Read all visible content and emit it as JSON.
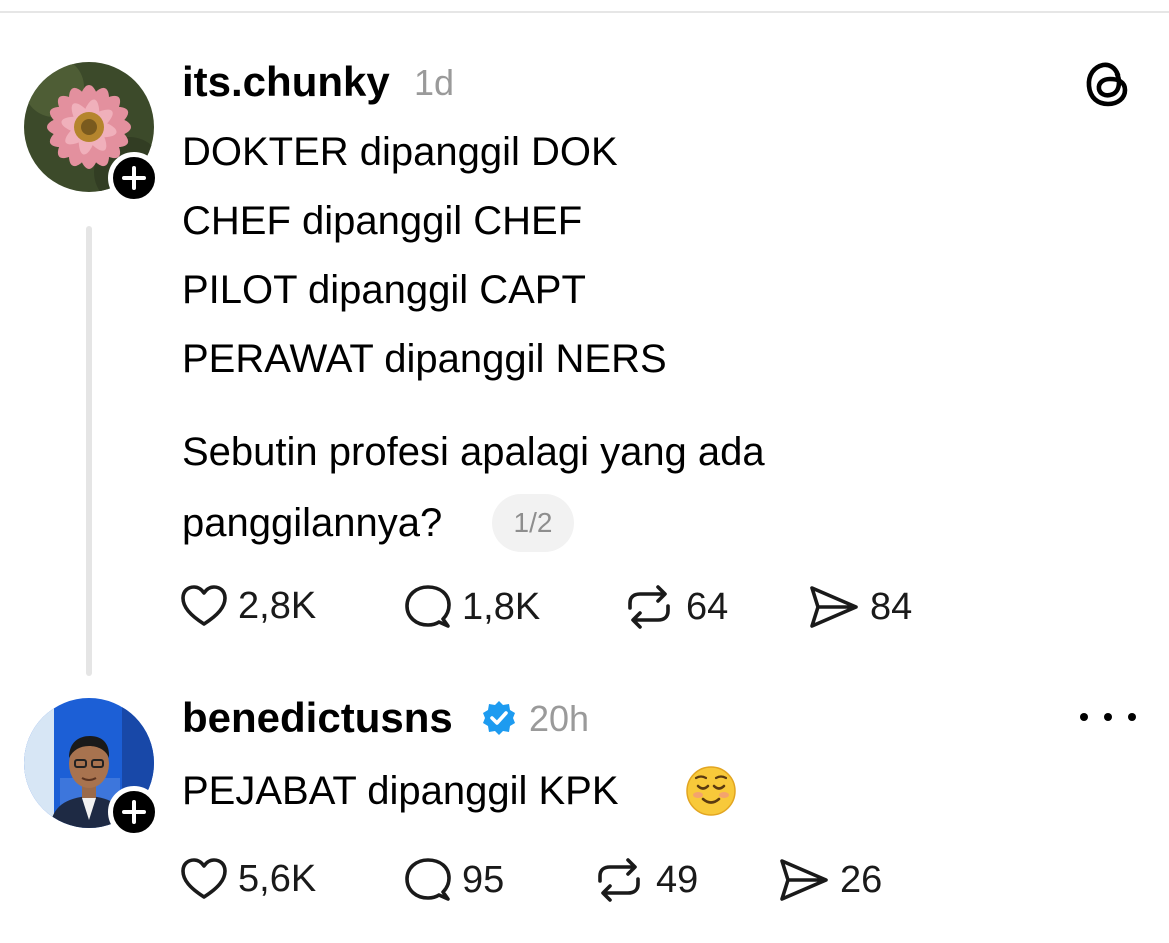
{
  "post": {
    "username": "its.chunky",
    "time": "1d",
    "lines": [
      "DOKTER dipanggil DOK",
      "CHEF dipanggil CHEF",
      "PILOT dipanggil CAPT",
      "PERAWAT dipanggil NERS",
      "Sebutin profesi apalagi yang ada",
      "panggilannya?"
    ],
    "page_indicator": "1/2",
    "actions": {
      "likes": "2,8K",
      "replies": "1,8K",
      "reposts": "64",
      "shares": "84"
    },
    "icons": {
      "avatar": "pink-flower-avatar",
      "follow": "plus-icon",
      "logo": "threads-logo-icon"
    }
  },
  "reply": {
    "username": "benedictusns",
    "verified": true,
    "time": "20h",
    "text": "PEJABAT dipanggil KPK",
    "emoji": "☺️",
    "actions": {
      "likes": "5,6K",
      "replies": "95",
      "reposts": "49",
      "shares": "26"
    },
    "icons": {
      "avatar": "man-in-suit-avatar",
      "follow": "plus-icon",
      "verified": "verified-badge-icon",
      "more": "more-horizontal-icon"
    }
  },
  "colors": {
    "text": "#000000",
    "muted": "#9a9a9a",
    "verified_blue": "#1d9bf0",
    "thread_line": "#e5e5e5"
  }
}
